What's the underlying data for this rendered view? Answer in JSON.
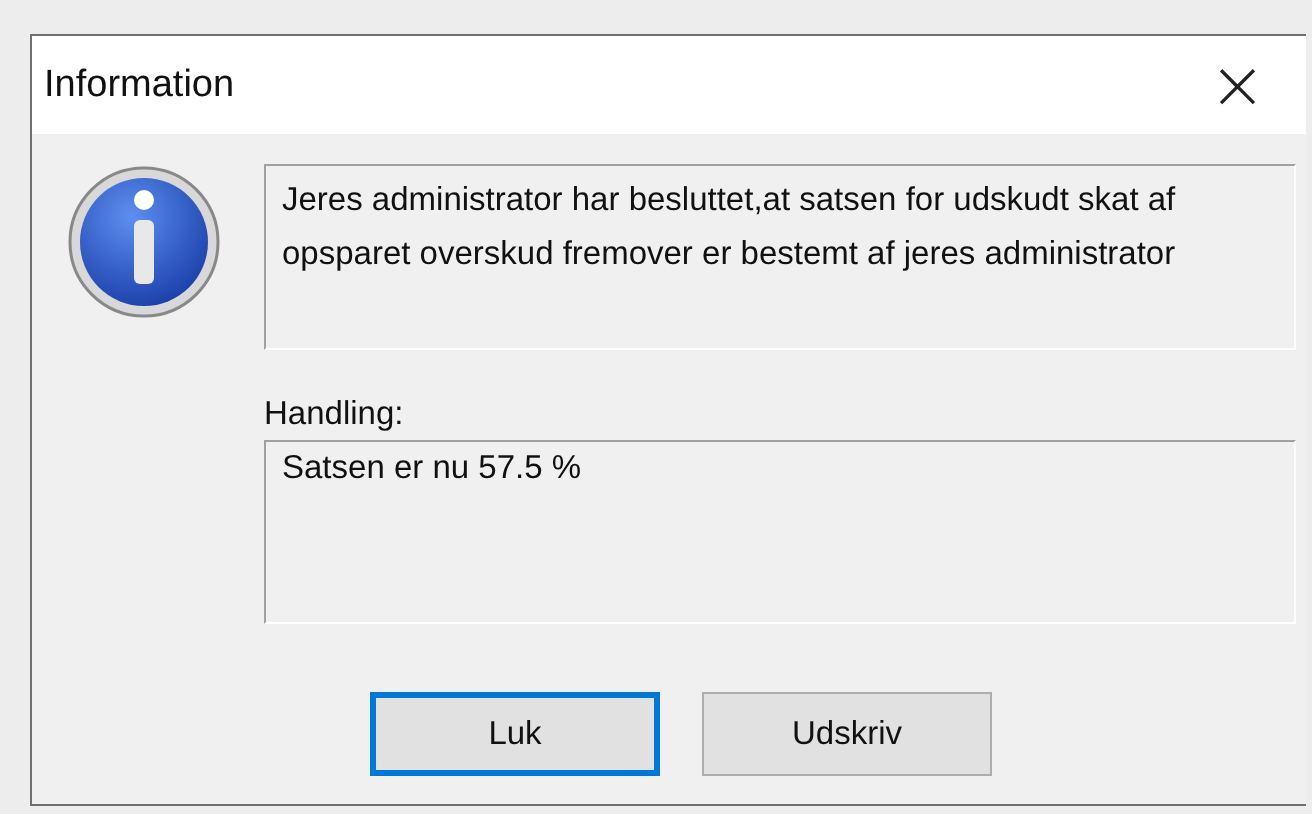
{
  "window": {
    "title": "Information",
    "close": "×"
  },
  "message": "Jeres administrator har besluttet,at satsen for udskudt skat af opsparet overskud fremover er bestemt af jeres administrator",
  "action": {
    "label": "Handling:",
    "value": "Satsen er nu 57.5 %"
  },
  "buttons": [
    {
      "label": "Luk",
      "focused": true
    },
    {
      "label": "Udskriv",
      "focused": false
    }
  ]
}
